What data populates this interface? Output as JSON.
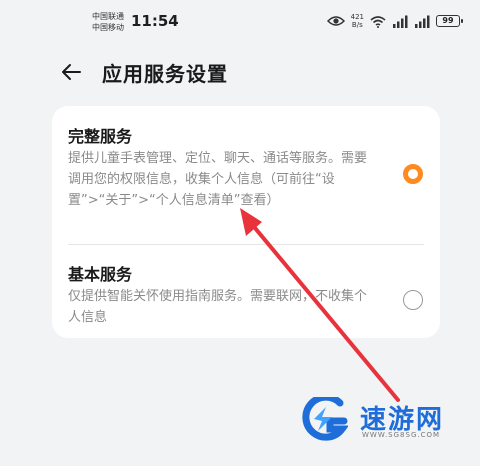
{
  "status_bar": {
    "carrier_1": "中国联通",
    "carrier_2": "中国移动",
    "time": "11:54",
    "speed_value": "421",
    "speed_unit": "B/s",
    "battery": "99"
  },
  "header": {
    "title": "应用服务设置"
  },
  "options": [
    {
      "title": "完整服务",
      "description": "提供儿童手表管理、定位、聊天、通话等服务。需要调用您的权限信息，收集个人信息（可前往“设置”>“关于”>“个人信息清单”查看）",
      "selected": true
    },
    {
      "title": "基本服务",
      "description": "仅提供智能关怀使用指南服务。需要联网，不收集个人信息",
      "selected": false
    }
  ],
  "watermark": {
    "name": "速游网",
    "url": "WWW.SG8SG.COM"
  },
  "colors": {
    "accent": "#ff8a1f",
    "annotation": "#e8323c",
    "watermark": "#1e6dd8"
  }
}
